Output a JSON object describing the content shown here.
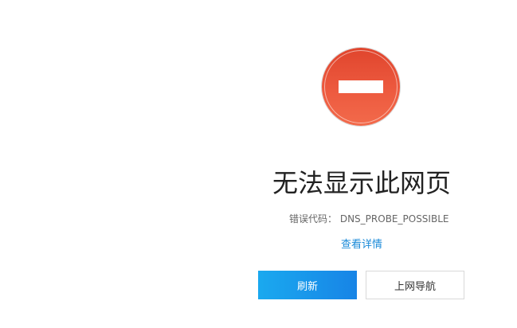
{
  "error": {
    "title": "无法显示此网页",
    "code_label": "错误代码：",
    "code_value": "DNS_PROBE_POSSIBLE",
    "details_link": "查看详情"
  },
  "buttons": {
    "refresh_label": "刷新",
    "nav_label": "上网导航"
  },
  "colors": {
    "icon_red": "#e8503a",
    "link_blue": "#1a8ad8",
    "button_blue": "#1a97ea"
  },
  "icons": {
    "error": "no-entry-icon"
  }
}
